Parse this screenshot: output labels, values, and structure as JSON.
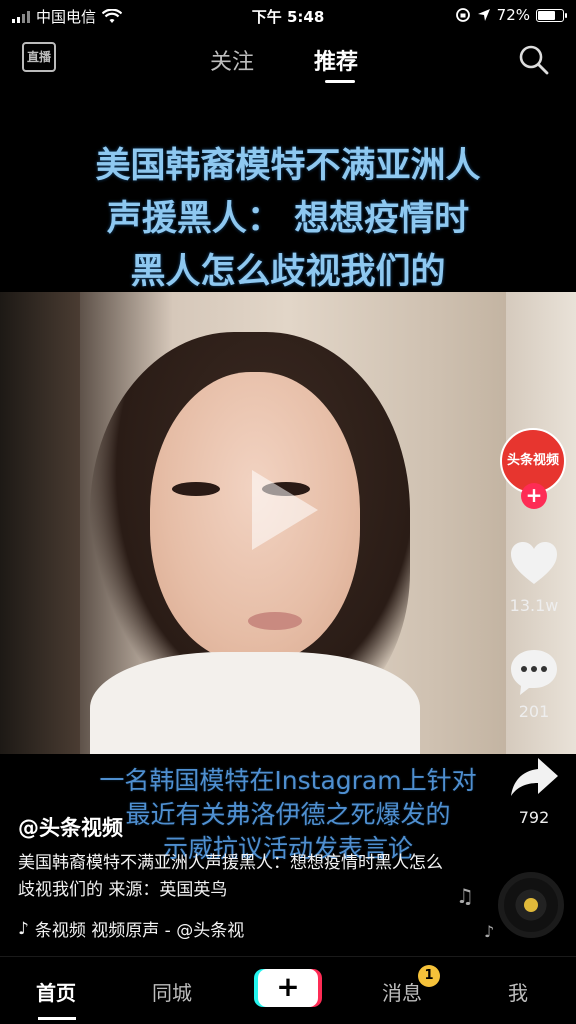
{
  "status_bar": {
    "carrier": "中国电信",
    "time": "下午 5:48",
    "battery_percent": "72%",
    "battery_level": 0.72
  },
  "top_nav": {
    "live_label": "直播",
    "tabs": [
      {
        "label": "关注",
        "active": false
      },
      {
        "label": "推荐",
        "active": true
      }
    ]
  },
  "video": {
    "title_lines": [
      "美国韩裔模特不满亚洲人",
      "声援黑人：  想想疫情时",
      "黑人怎么歧视我们的"
    ],
    "subtitle_lines": [
      "一名韩国模特在Instagram上针对",
      "最近有关弗洛伊德之死爆发的",
      "示威抗议活动发表言论"
    ]
  },
  "right_rail": {
    "avatar_text": "头条视频",
    "follow_symbol": "+",
    "like_count": "13.1w",
    "comment_count": "201",
    "share_count": "792"
  },
  "info": {
    "author": "@头条视频",
    "description": "美国韩裔模特不满亚洲人声援黑人：想想疫情时黑人怎么歧视我们的 来源：英国英鸟",
    "music_text": "条视频    视频原声 - @头条视"
  },
  "tab_bar": {
    "items": [
      {
        "label": "首页",
        "active": true
      },
      {
        "label": "同城",
        "active": false
      },
      {
        "label": "+",
        "active": false
      },
      {
        "label": "消息",
        "active": false
      },
      {
        "label": "我",
        "active": false
      }
    ],
    "message_badge": "1"
  },
  "colors": {
    "title_blue": "#8ec8f0",
    "subtitle_blue": "#4f8fd0",
    "accent_red": "#fe2c55",
    "badge_yellow": "#f6c23a"
  },
  "icons": [
    "signal-icon",
    "wifi-icon",
    "lock-rotation-icon",
    "location-icon",
    "battery-icon",
    "live-icon",
    "search-icon",
    "heart-icon",
    "comment-icon",
    "share-icon",
    "music-note-icon",
    "music-disc-icon"
  ]
}
